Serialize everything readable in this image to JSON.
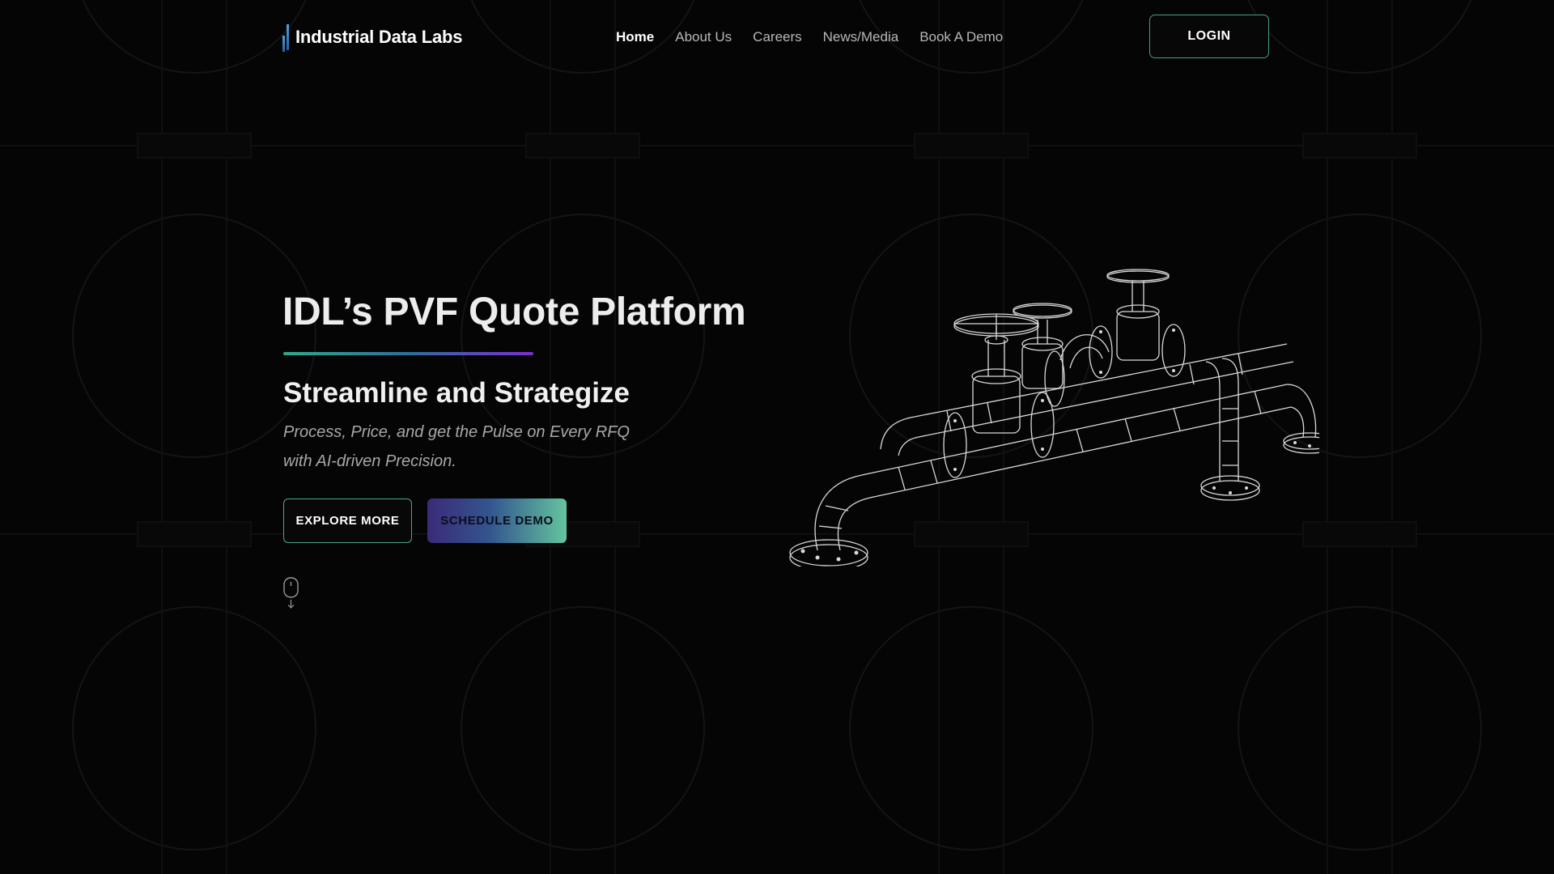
{
  "window": {
    "width": 1920,
    "height": 1080
  },
  "brand": {
    "name": "Industrial Data Labs",
    "accent_colors": [
      "#2fa98a",
      "#2e6f9e",
      "#7b2fd0"
    ]
  },
  "nav": {
    "items": [
      {
        "label": "Home",
        "active": true
      },
      {
        "label": "About Us",
        "active": false
      },
      {
        "label": "Careers",
        "active": false
      },
      {
        "label": "News/Media",
        "active": false
      },
      {
        "label": "Book A Demo",
        "active": false
      }
    ],
    "login_label": "LOGIN"
  },
  "hero": {
    "title": "IDL’s PVF Quote Platform",
    "subtitle": "Streamline and Strategize",
    "description": "Process, Price, and get the Pulse on Every RFQ with AI-driven Precision.",
    "primary_button": "EXPLORE MORE",
    "secondary_button": "SCHEDULE DEMO"
  },
  "icons": {
    "logo": "bar-chart-icon",
    "scroll": "mouse-scroll-icon",
    "illustration": "pipe-valve-wireframe-icon"
  },
  "colors": {
    "background": "#050505",
    "button_border": "#4aa58c",
    "nav_inactive": "#b7b7b7"
  }
}
